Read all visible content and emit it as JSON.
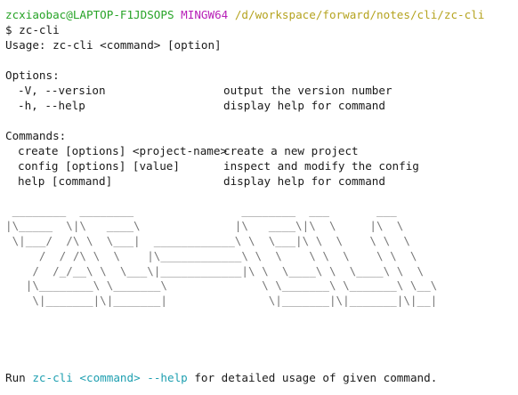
{
  "prompt": {
    "user_host": "zcxiaobac@LAPTOP-F1JDSOPS",
    "shell": "MINGW64",
    "path": "/d/workspace/forward/notes/cli/zc-cli"
  },
  "command": "$ zc-cli",
  "usage": "Usage: zc-cli <command> [option]",
  "options": {
    "heading": "Options:",
    "items": [
      {
        "flag": "-V, --version",
        "desc": "output the version number"
      },
      {
        "flag": "-h, --help",
        "desc": "display help for command"
      }
    ]
  },
  "commands": {
    "heading": "Commands:",
    "items": [
      {
        "cmd": "create [options] <project-name>",
        "desc": "create a new project"
      },
      {
        "cmd": "config [options] [value]",
        "desc": "inspect and modify the config"
      },
      {
        "cmd": "help [command]",
        "desc": "display help for command"
      }
    ]
  },
  "ascii_art": [
    " ________  ________                ________  ___       ___",
    "|\\_____  \\|\\   ____\\              |\\   ____\\|\\  \\     |\\  \\",
    " \\|___/  /\\ \\  \\___|  ____________\\ \\  \\___|\\ \\  \\    \\ \\  \\",
    "     /  / /\\ \\  \\    |\\____________\\ \\  \\    \\ \\  \\    \\ \\  \\",
    "    /  /_/__\\ \\  \\___\\|____________|\\ \\  \\____\\ \\  \\____\\ \\  \\",
    "   |\\________\\ \\_______\\              \\ \\_______\\ \\_______\\ \\__\\",
    "    \\|_______|\\|_______|               \\|_______|\\|_______|\\|__|"
  ],
  "footer": {
    "run": "Run",
    "cmd": "zc-cli <command> --help",
    "rest": "for detailed usage of given command."
  },
  "colors": {
    "user_host": "#27a327",
    "shell": "#b71fb7",
    "path": "#b5a31f",
    "highlight": "#1e9fb0"
  }
}
